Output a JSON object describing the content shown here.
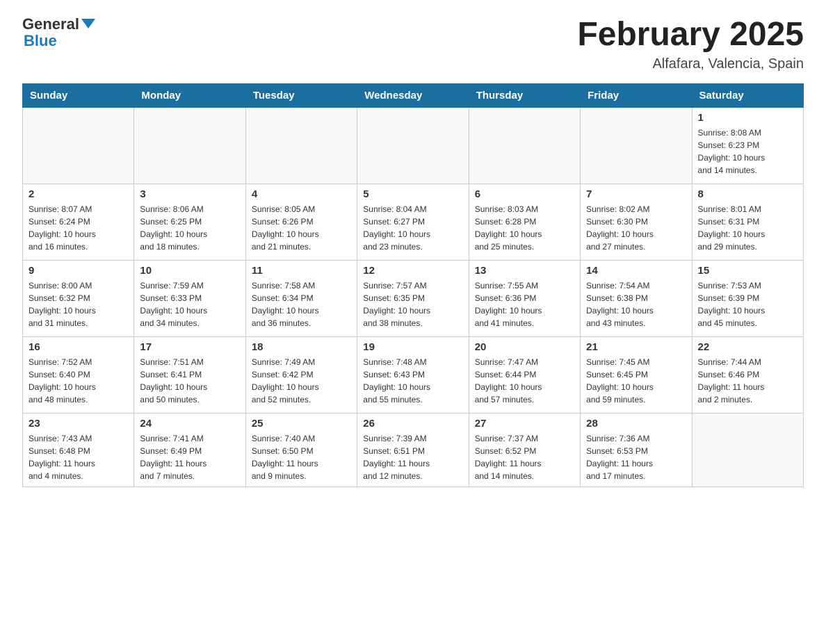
{
  "header": {
    "logo_general": "General",
    "logo_blue": "Blue",
    "title": "February 2025",
    "location": "Alfafara, Valencia, Spain"
  },
  "days_of_week": [
    "Sunday",
    "Monday",
    "Tuesday",
    "Wednesday",
    "Thursday",
    "Friday",
    "Saturday"
  ],
  "weeks": [
    [
      {
        "day": "",
        "info": ""
      },
      {
        "day": "",
        "info": ""
      },
      {
        "day": "",
        "info": ""
      },
      {
        "day": "",
        "info": ""
      },
      {
        "day": "",
        "info": ""
      },
      {
        "day": "",
        "info": ""
      },
      {
        "day": "1",
        "info": "Sunrise: 8:08 AM\nSunset: 6:23 PM\nDaylight: 10 hours\nand 14 minutes."
      }
    ],
    [
      {
        "day": "2",
        "info": "Sunrise: 8:07 AM\nSunset: 6:24 PM\nDaylight: 10 hours\nand 16 minutes."
      },
      {
        "day": "3",
        "info": "Sunrise: 8:06 AM\nSunset: 6:25 PM\nDaylight: 10 hours\nand 18 minutes."
      },
      {
        "day": "4",
        "info": "Sunrise: 8:05 AM\nSunset: 6:26 PM\nDaylight: 10 hours\nand 21 minutes."
      },
      {
        "day": "5",
        "info": "Sunrise: 8:04 AM\nSunset: 6:27 PM\nDaylight: 10 hours\nand 23 minutes."
      },
      {
        "day": "6",
        "info": "Sunrise: 8:03 AM\nSunset: 6:28 PM\nDaylight: 10 hours\nand 25 minutes."
      },
      {
        "day": "7",
        "info": "Sunrise: 8:02 AM\nSunset: 6:30 PM\nDaylight: 10 hours\nand 27 minutes."
      },
      {
        "day": "8",
        "info": "Sunrise: 8:01 AM\nSunset: 6:31 PM\nDaylight: 10 hours\nand 29 minutes."
      }
    ],
    [
      {
        "day": "9",
        "info": "Sunrise: 8:00 AM\nSunset: 6:32 PM\nDaylight: 10 hours\nand 31 minutes."
      },
      {
        "day": "10",
        "info": "Sunrise: 7:59 AM\nSunset: 6:33 PM\nDaylight: 10 hours\nand 34 minutes."
      },
      {
        "day": "11",
        "info": "Sunrise: 7:58 AM\nSunset: 6:34 PM\nDaylight: 10 hours\nand 36 minutes."
      },
      {
        "day": "12",
        "info": "Sunrise: 7:57 AM\nSunset: 6:35 PM\nDaylight: 10 hours\nand 38 minutes."
      },
      {
        "day": "13",
        "info": "Sunrise: 7:55 AM\nSunset: 6:36 PM\nDaylight: 10 hours\nand 41 minutes."
      },
      {
        "day": "14",
        "info": "Sunrise: 7:54 AM\nSunset: 6:38 PM\nDaylight: 10 hours\nand 43 minutes."
      },
      {
        "day": "15",
        "info": "Sunrise: 7:53 AM\nSunset: 6:39 PM\nDaylight: 10 hours\nand 45 minutes."
      }
    ],
    [
      {
        "day": "16",
        "info": "Sunrise: 7:52 AM\nSunset: 6:40 PM\nDaylight: 10 hours\nand 48 minutes."
      },
      {
        "day": "17",
        "info": "Sunrise: 7:51 AM\nSunset: 6:41 PM\nDaylight: 10 hours\nand 50 minutes."
      },
      {
        "day": "18",
        "info": "Sunrise: 7:49 AM\nSunset: 6:42 PM\nDaylight: 10 hours\nand 52 minutes."
      },
      {
        "day": "19",
        "info": "Sunrise: 7:48 AM\nSunset: 6:43 PM\nDaylight: 10 hours\nand 55 minutes."
      },
      {
        "day": "20",
        "info": "Sunrise: 7:47 AM\nSunset: 6:44 PM\nDaylight: 10 hours\nand 57 minutes."
      },
      {
        "day": "21",
        "info": "Sunrise: 7:45 AM\nSunset: 6:45 PM\nDaylight: 10 hours\nand 59 minutes."
      },
      {
        "day": "22",
        "info": "Sunrise: 7:44 AM\nSunset: 6:46 PM\nDaylight: 11 hours\nand 2 minutes."
      }
    ],
    [
      {
        "day": "23",
        "info": "Sunrise: 7:43 AM\nSunset: 6:48 PM\nDaylight: 11 hours\nand 4 minutes."
      },
      {
        "day": "24",
        "info": "Sunrise: 7:41 AM\nSunset: 6:49 PM\nDaylight: 11 hours\nand 7 minutes."
      },
      {
        "day": "25",
        "info": "Sunrise: 7:40 AM\nSunset: 6:50 PM\nDaylight: 11 hours\nand 9 minutes."
      },
      {
        "day": "26",
        "info": "Sunrise: 7:39 AM\nSunset: 6:51 PM\nDaylight: 11 hours\nand 12 minutes."
      },
      {
        "day": "27",
        "info": "Sunrise: 7:37 AM\nSunset: 6:52 PM\nDaylight: 11 hours\nand 14 minutes."
      },
      {
        "day": "28",
        "info": "Sunrise: 7:36 AM\nSunset: 6:53 PM\nDaylight: 11 hours\nand 17 minutes."
      },
      {
        "day": "",
        "info": ""
      }
    ]
  ]
}
